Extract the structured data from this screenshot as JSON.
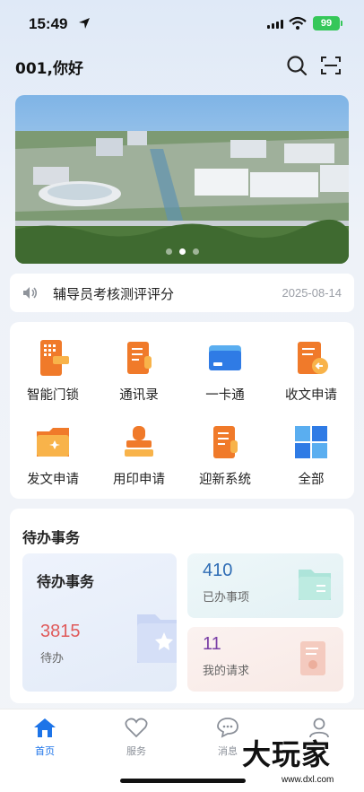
{
  "status_bar": {
    "time": "15:49",
    "battery": "99"
  },
  "header": {
    "greeting": "001,你好"
  },
  "banner": {
    "page_count": 3,
    "active_page": 2
  },
  "notice": {
    "text": "辅导员考核测评评分",
    "date": "2025-08-14"
  },
  "grid": {
    "items": [
      {
        "label": "智能门锁",
        "icon": "smart-lock-icon",
        "color": "#f07a2a"
      },
      {
        "label": "通讯录",
        "icon": "contacts-icon",
        "color": "#f07a2a"
      },
      {
        "label": "一卡通",
        "icon": "card-icon",
        "color": "#2f7be5"
      },
      {
        "label": "收文申请",
        "icon": "receive-document-icon",
        "color": "#f07a2a"
      },
      {
        "label": "发文申请",
        "icon": "send-document-icon",
        "color": "#f07a2a"
      },
      {
        "label": "用印申请",
        "icon": "seal-icon",
        "color": "#f07a2a"
      },
      {
        "label": "迎新系统",
        "icon": "welcome-system-icon",
        "color": "#f07a2a"
      },
      {
        "label": "全部",
        "icon": "all-apps-icon",
        "color": "#2f7be5"
      }
    ]
  },
  "pending": {
    "section_title": "待办事务",
    "main": {
      "title": "待办事务",
      "count": "3815",
      "label": "待办"
    },
    "done": {
      "count": "410",
      "label": "已办事项"
    },
    "requests": {
      "count": "11",
      "label": "我的请求"
    }
  },
  "tabbar": {
    "tabs": [
      {
        "label": "首页",
        "icon": "home-icon",
        "active": true
      },
      {
        "label": "服务",
        "icon": "heart-icon",
        "active": false
      },
      {
        "label": "消息",
        "icon": "message-icon",
        "active": false
      },
      {
        "label": "",
        "icon": "user-icon",
        "active": false
      }
    ]
  },
  "watermark": {
    "text": "大玩家",
    "sub": "www.dxl.com"
  },
  "colors": {
    "accent": "#1d74e8",
    "pending_red": "#e05a5a",
    "done_blue": "#2f6db5",
    "request_purple": "#7a3fa6"
  }
}
